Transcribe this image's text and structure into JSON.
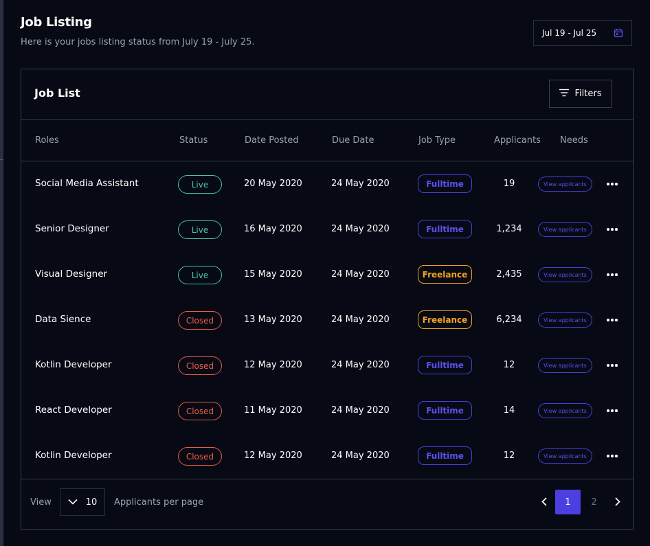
{
  "header": {
    "title": "Job Listing",
    "subtitle": "Here is your jobs listing status from July 19 - July 25.",
    "date_range": "Jul 19 - Jul 25",
    "calendar_icon": "calendar-icon"
  },
  "card": {
    "title": "Job List",
    "filters_label": "Filters",
    "filters_icon": "filter-lines-icon"
  },
  "table": {
    "columns": [
      "Roles",
      "Status",
      "Date Posted",
      "Due Date",
      "Job Type",
      "Applicants",
      "Needs"
    ],
    "rows": [
      {
        "role": "Social Media Assistant",
        "status": "Live",
        "posted": "20 May 2020",
        "due": "24 May 2020",
        "type": "Fulltime",
        "applicants": "19",
        "action": "View applicants"
      },
      {
        "role": "Senior Designer",
        "status": "Live",
        "posted": "16 May 2020",
        "due": "24 May 2020",
        "type": "Fulltime",
        "applicants": "1,234",
        "action": "View applicants"
      },
      {
        "role": "Visual Designer",
        "status": "Live",
        "posted": "15 May 2020",
        "due": "24 May 2020",
        "type": "Freelance",
        "applicants": "2,435",
        "action": "View applicants"
      },
      {
        "role": "Data Sience",
        "status": "Closed",
        "posted": "13 May 2020",
        "due": "24 May 2020",
        "type": "Freelance",
        "applicants": "6,234",
        "action": "View applicants"
      },
      {
        "role": "Kotlin Developer",
        "status": "Closed",
        "posted": "12 May 2020",
        "due": "24 May 2020",
        "type": "Fulltime",
        "applicants": "12",
        "action": "View applicants"
      },
      {
        "role": "React Developer",
        "status": "Closed",
        "posted": "11 May 2020",
        "due": "24 May 2020",
        "type": "Fulltime",
        "applicants": "14",
        "action": "View applicants"
      },
      {
        "role": "Kotlin Developer",
        "status": "Closed",
        "posted": "12 May 2020",
        "due": "24 May 2020",
        "type": "Fulltime",
        "applicants": "12",
        "action": "View applicants"
      }
    ]
  },
  "footer": {
    "view_label": "View",
    "per_page_value": "10",
    "per_page_label": "Applicants per page",
    "pages": [
      "1",
      "2"
    ],
    "current_page": "1"
  },
  "colors": {
    "background": "#070a14",
    "accent": "#4b3fe0",
    "live": "#49c3a6",
    "closed": "#ef5b43",
    "freelance": "#f4a31f",
    "muted_text": "#9aa0ae",
    "border": "#3a3f4c"
  }
}
